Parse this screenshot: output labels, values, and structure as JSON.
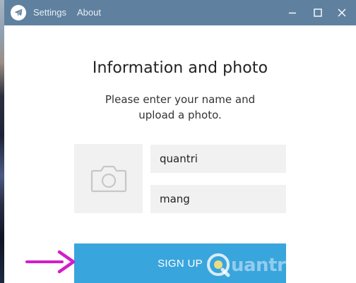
{
  "menu": {
    "settings": "Settings",
    "about": "About"
  },
  "window_controls": {
    "minimize_icon": "minimize-icon",
    "maximize_icon": "maximize-icon",
    "close_icon": "close-icon"
  },
  "form": {
    "title": "Information and photo",
    "subtitle_line1": "Please enter your name and",
    "subtitle_line2": "upload a photo.",
    "photo_icon": "camera-icon",
    "first_name_value": "quantri",
    "last_name_value": "mang",
    "signup_label": "SIGN UP"
  },
  "colors": {
    "titlebar": "#5f819f",
    "accent": "#39a5dd",
    "field_bg": "#f1f1f1",
    "arrow": "#d21fc8"
  }
}
